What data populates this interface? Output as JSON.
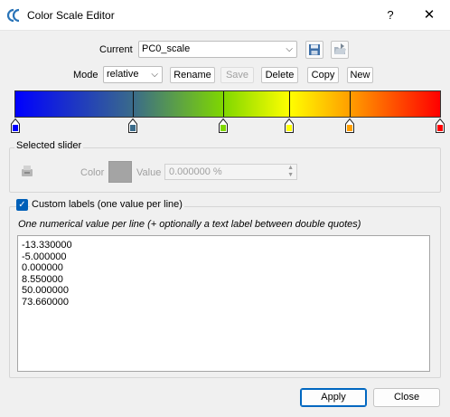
{
  "window": {
    "title": "Color Scale Editor",
    "help_label": "?",
    "close_label": "✕"
  },
  "current": {
    "label": "Current",
    "value": "PC0_scale"
  },
  "mode": {
    "label": "Mode",
    "value": "relative"
  },
  "actions": {
    "rename": "Rename",
    "save": "Save",
    "delete": "Delete",
    "copy": "Copy",
    "new": "New"
  },
  "scale": {
    "gradient_colors": [
      "#0000ff",
      "#3a6b8a",
      "#7fd700",
      "#ffff00",
      "#ff9f00",
      "#ff0000"
    ],
    "sliders": [
      {
        "color": "#0000ff",
        "position_fraction": 0.0
      },
      {
        "color": "#3a6b8a",
        "position_fraction": 0.2773
      },
      {
        "color": "#7fd700",
        "position_fraction": 0.4891
      },
      {
        "color": "#ffff00",
        "position_fraction": 0.6453
      },
      {
        "color": "#ff9f00",
        "position_fraction": 0.7863
      },
      {
        "color": "#ff0000",
        "position_fraction": 1.0
      }
    ]
  },
  "selected_slider": {
    "title": "Selected slider",
    "color_label": "Color",
    "value_label": "Value",
    "value_text": "0.000000 %"
  },
  "custom_labels": {
    "checked": true,
    "label": "Custom labels (one value per line)",
    "hint": "One numerical value per line (+ optionally a text label between double quotes)",
    "text": "-13.330000\n-5.000000\n0.000000\n8.550000\n50.000000\n73.660000"
  },
  "footer": {
    "apply": "Apply",
    "close": "Close"
  }
}
